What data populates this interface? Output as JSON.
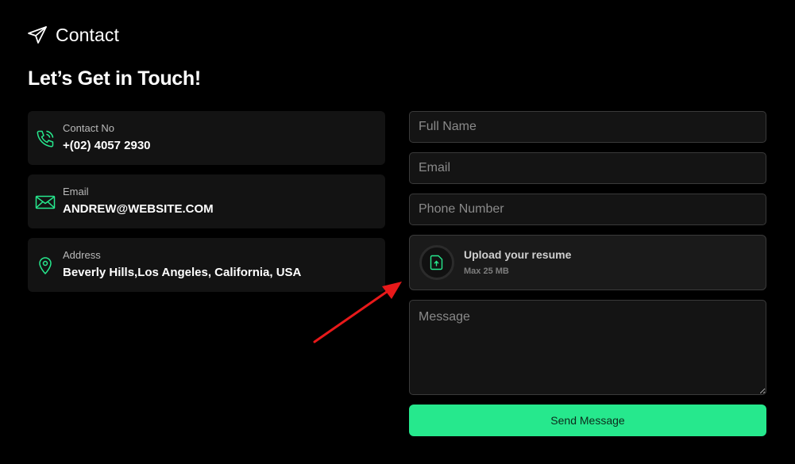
{
  "header": {
    "section_label": "Contact",
    "section_icon": "paper-plane-icon",
    "title": "Let’s Get in Touch!"
  },
  "info_cards": [
    {
      "label": "Contact No",
      "value": "+(02) 4057 2930",
      "icon": "phone-icon"
    },
    {
      "label": "Email",
      "value": "ANDREW@WEBSITE.COM",
      "icon": "envelope-icon"
    },
    {
      "label": "Address",
      "value": "Beverly Hills,Los Angeles, California, USA",
      "icon": "map-pin-icon"
    }
  ],
  "form": {
    "full_name_placeholder": "Full Name",
    "email_placeholder": "Email",
    "phone_placeholder": "Phone Number",
    "upload_title": "Upload your resume",
    "upload_subtitle": "Max 25 MB",
    "message_placeholder": "Message",
    "submit_label": "Send Message"
  },
  "colors": {
    "background": "#000000",
    "card": "#131313",
    "accent": "#26e88d",
    "annotation_arrow": "#e8191a"
  }
}
